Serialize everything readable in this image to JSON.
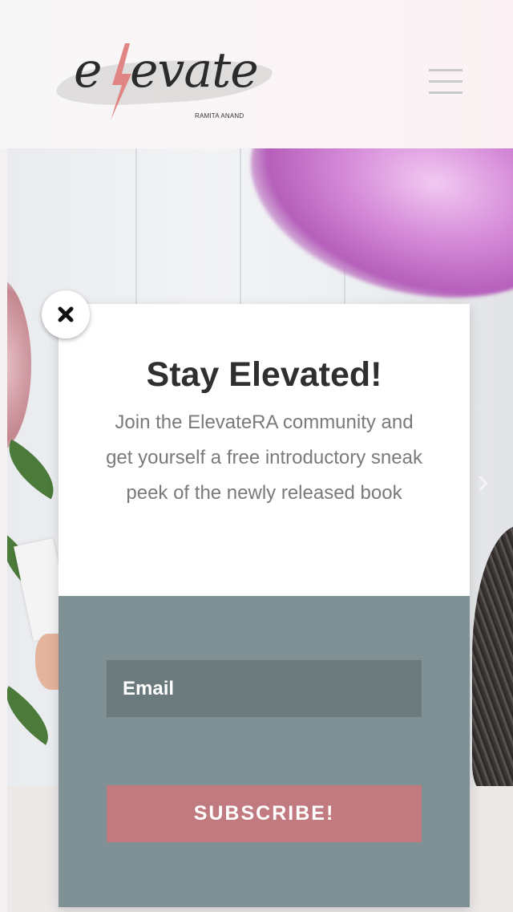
{
  "header": {
    "logo_text": "evate",
    "logo_sub": "RAMITA ANAND",
    "menu_icon": "hamburger-icon"
  },
  "popup": {
    "title": "Stay Elevated!",
    "text": "Join the ElevateRA community and get yourself a free introductory sneak peek of the newly released book",
    "email_placeholder": "Email",
    "subscribe_label": "SUBSCRIBE!",
    "close_icon": "close-icon",
    "colors": {
      "form_bg": "#7f9194",
      "input_bg": "#6a7a7d",
      "button_bg": "#c17b80"
    }
  }
}
